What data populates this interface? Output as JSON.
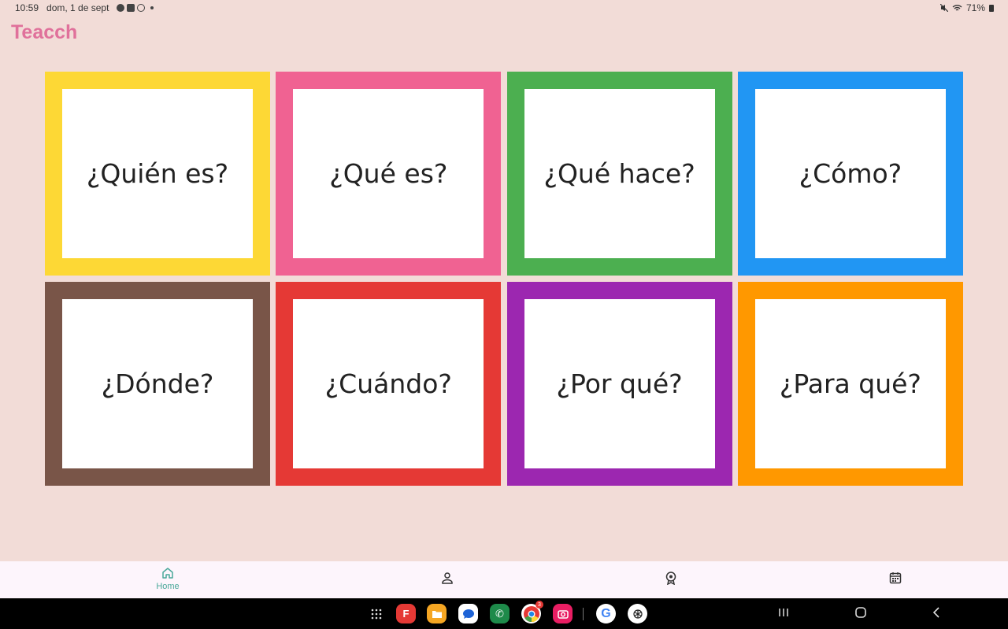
{
  "status": {
    "time": "10:59",
    "date": "dom, 1 de sept",
    "battery": "71%",
    "left_icons": [
      "weather-icon",
      "facebook-icon",
      "b-icon",
      "dot"
    ],
    "right_icons": [
      "mute-icon",
      "wifi-icon",
      "battery-icon"
    ]
  },
  "app": {
    "title": "Teacch",
    "title_color": "#e0719b"
  },
  "cards": [
    {
      "label": "¿Quién es?",
      "color": "#fdd835"
    },
    {
      "label": "¿Qué es?",
      "color": "#f06292"
    },
    {
      "label": "¿Qué hace?",
      "color": "#4caf50"
    },
    {
      "label": "¿Cómo?",
      "color": "#2196f3"
    },
    {
      "label": "¿Dónde?",
      "color": "#795548"
    },
    {
      "label": "¿Cuándo?",
      "color": "#e53935"
    },
    {
      "label": "¿Por qué?",
      "color": "#9c27b0"
    },
    {
      "label": "¿Para qué?",
      "color": "#ff9800"
    }
  ],
  "bottom_nav": {
    "items": [
      {
        "name": "home",
        "label": "Home",
        "icon": "home-icon",
        "active": true
      },
      {
        "name": "profile",
        "label": "",
        "icon": "person-icon",
        "active": false
      },
      {
        "name": "awards",
        "label": "",
        "icon": "award-icon",
        "active": false
      },
      {
        "name": "calendar",
        "label": "",
        "icon": "calendar-icon",
        "active": false
      }
    ],
    "active_color": "#4aa89a"
  },
  "dock": {
    "apps": [
      {
        "name": "apps-grid-icon",
        "color": ""
      },
      {
        "name": "flipboard-icon",
        "color": "#e53935"
      },
      {
        "name": "files-icon",
        "color": "#f5a623"
      },
      {
        "name": "messages-icon",
        "color": "#ffffff"
      },
      {
        "name": "phone-icon",
        "color": "#1e8a4a"
      },
      {
        "name": "chrome-icon",
        "color": "#ffffff",
        "badge": "3"
      },
      {
        "name": "camera-icon",
        "color": "#e91e63"
      },
      {
        "name": "google-icon",
        "color": "#ffffff"
      },
      {
        "name": "chatgpt-icon",
        "color": "#ffffff"
      }
    ]
  }
}
